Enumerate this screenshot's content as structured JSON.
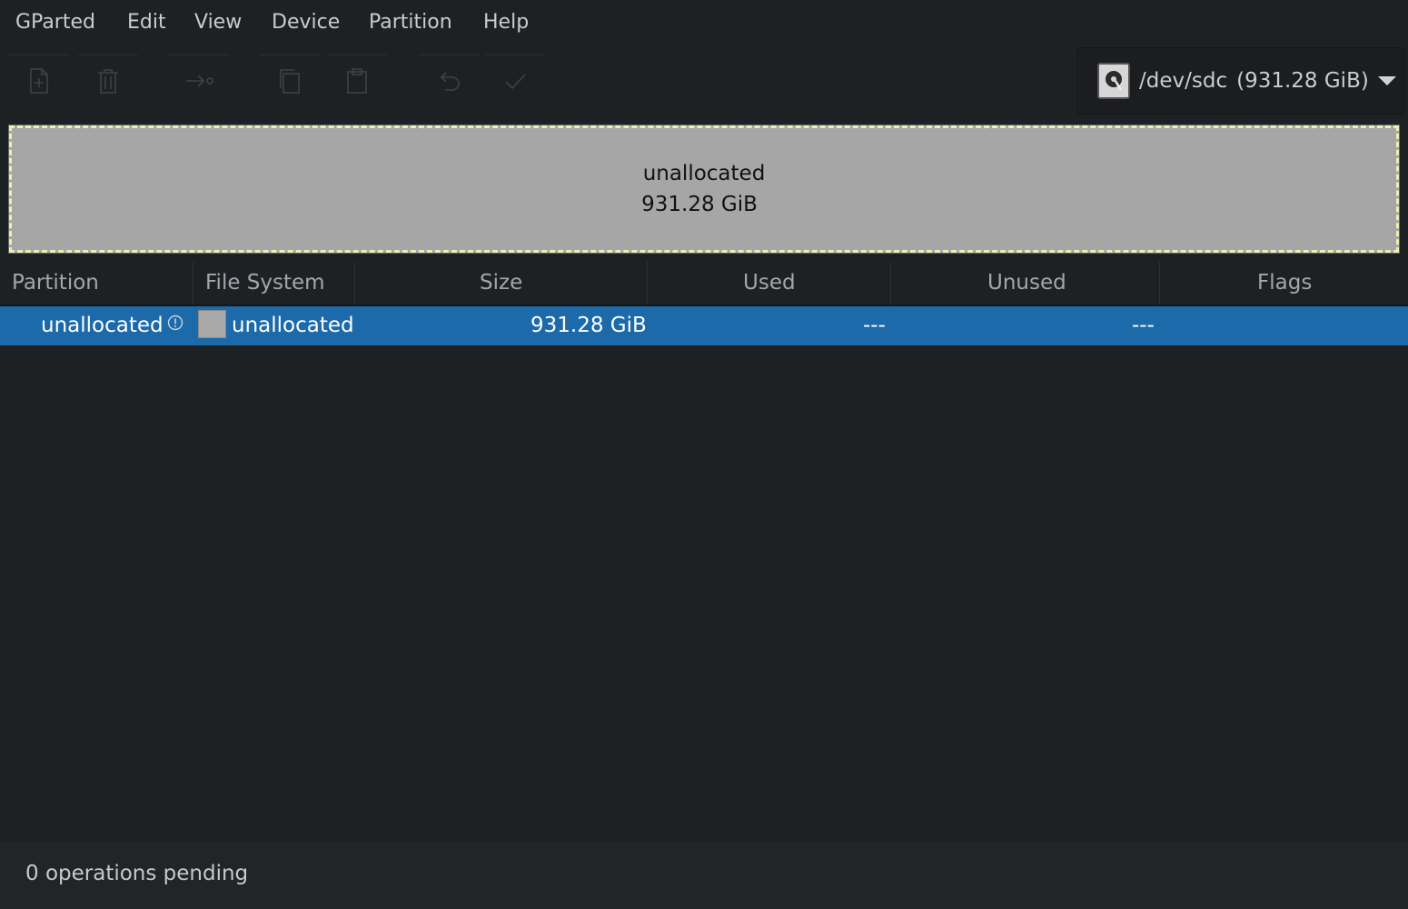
{
  "menubar": {
    "items": [
      "GParted",
      "Edit",
      "View",
      "Device",
      "Partition",
      "Help"
    ]
  },
  "toolbar": {
    "buttons": [
      {
        "name": "new-partition",
        "icon": "new-document-icon",
        "enabled": false
      },
      {
        "name": "delete-partition",
        "icon": "trash-icon",
        "enabled": false
      },
      {
        "name": "resize-move",
        "icon": "resize-move-icon",
        "enabled": false
      },
      {
        "name": "copy",
        "icon": "copy-icon",
        "enabled": false
      },
      {
        "name": "paste",
        "icon": "paste-icon",
        "enabled": false
      },
      {
        "name": "undo",
        "icon": "undo-icon",
        "enabled": false
      },
      {
        "name": "apply",
        "icon": "check-icon",
        "enabled": false
      }
    ]
  },
  "device": {
    "path": "/dev/sdc",
    "size": "(931.28 GiB)",
    "icon": "harddisk-icon"
  },
  "disk_map": {
    "label": "unallocated",
    "size": "931.28 GiB",
    "color": "#a6a6a6",
    "border_color": "#f0efb0"
  },
  "table": {
    "columns": [
      "Partition",
      "File System",
      "Size",
      "Used",
      "Unused",
      "Flags"
    ],
    "rows": [
      {
        "partition": "unallocated",
        "filesystem": "unallocated",
        "size": "931.28 GiB",
        "used": "---",
        "unused": "---",
        "flags": ""
      }
    ],
    "selected_color": "#1c6aa9"
  },
  "status": {
    "text": "0 operations pending"
  }
}
